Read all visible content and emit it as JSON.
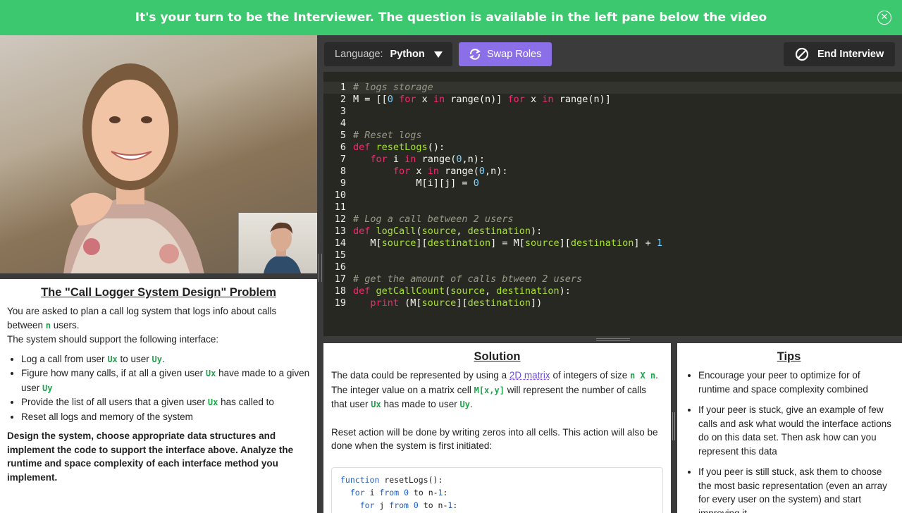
{
  "banner": {
    "message": "It's your turn to be the Interviewer. The question is available in the left pane below the video",
    "close_icon": "close-icon",
    "color": "#3bc86e"
  },
  "toolbar": {
    "language_label": "Language:",
    "language_value": "Python",
    "swap_label": "Swap Roles",
    "end_label": "End Interview",
    "swap_color": "#8b6fe8"
  },
  "problem": {
    "title": "The \"Call Logger System Design\" Problem",
    "intro_a": "You are asked to plan a call log system that logs info about calls between ",
    "intro_n": "n",
    "intro_b": " users.",
    "intro_c": "The system should support the following interface:",
    "items": [
      {
        "a": "Log a call from user ",
        "c1": "Ux",
        "b": " to user ",
        "c2": "Uy",
        "d": "."
      },
      {
        "a": "Figure how many calls, if at all a given user ",
        "c1": "Ux",
        "b": " have made to a given user ",
        "c2": "Uy",
        "d": ""
      },
      {
        "a": "Provide the list of all users that a given user ",
        "c1": "Ux",
        "b": " has called to",
        "c2": "",
        "d": ""
      },
      {
        "a": "Reset all logs and memory of the system",
        "c1": "",
        "b": "",
        "c2": "",
        "d": ""
      }
    ],
    "instruction": "Design the system, choose appropriate data structures and implement the code to support the interface above. Analyze the runtime and space complexity of each interface method you implement."
  },
  "editor": {
    "lines": [
      "1",
      "2",
      "3",
      "4",
      "5",
      "6",
      "7",
      "8",
      "9",
      "10",
      "11",
      "12",
      "13",
      "14",
      "15",
      "16",
      "17",
      "18",
      "19"
    ]
  },
  "solution": {
    "title": "Solution",
    "p1_a": "The data could be represented by using a ",
    "p1_link": "2D matrix",
    "p1_b": " of integers of size ",
    "p1_code": "n X n",
    "p1_c": ".",
    "p2_a": "The integer value on a matrix cell ",
    "p2_code": "M[x,y]",
    "p2_b": " will represent the number of calls that user ",
    "p2_ux": "Ux",
    "p2_c": " has made to user ",
    "p2_uy": "Uy",
    "p2_d": ".",
    "p3": "Reset action will be done by writing zeros into all cells. This action will also be done when the system is first initiated:"
  },
  "tips": {
    "title": "Tips",
    "items": [
      "Encourage your peer to optimize for of runtime and space complexity combined",
      "If your peer is stuck, give an example of few calls and ask what would the interface actions do on this data set. Then ask how can you represent this data",
      "If you peer is still stuck, ask them to choose the most basic representation (even an array for every user on the system) and start improving it"
    ]
  }
}
